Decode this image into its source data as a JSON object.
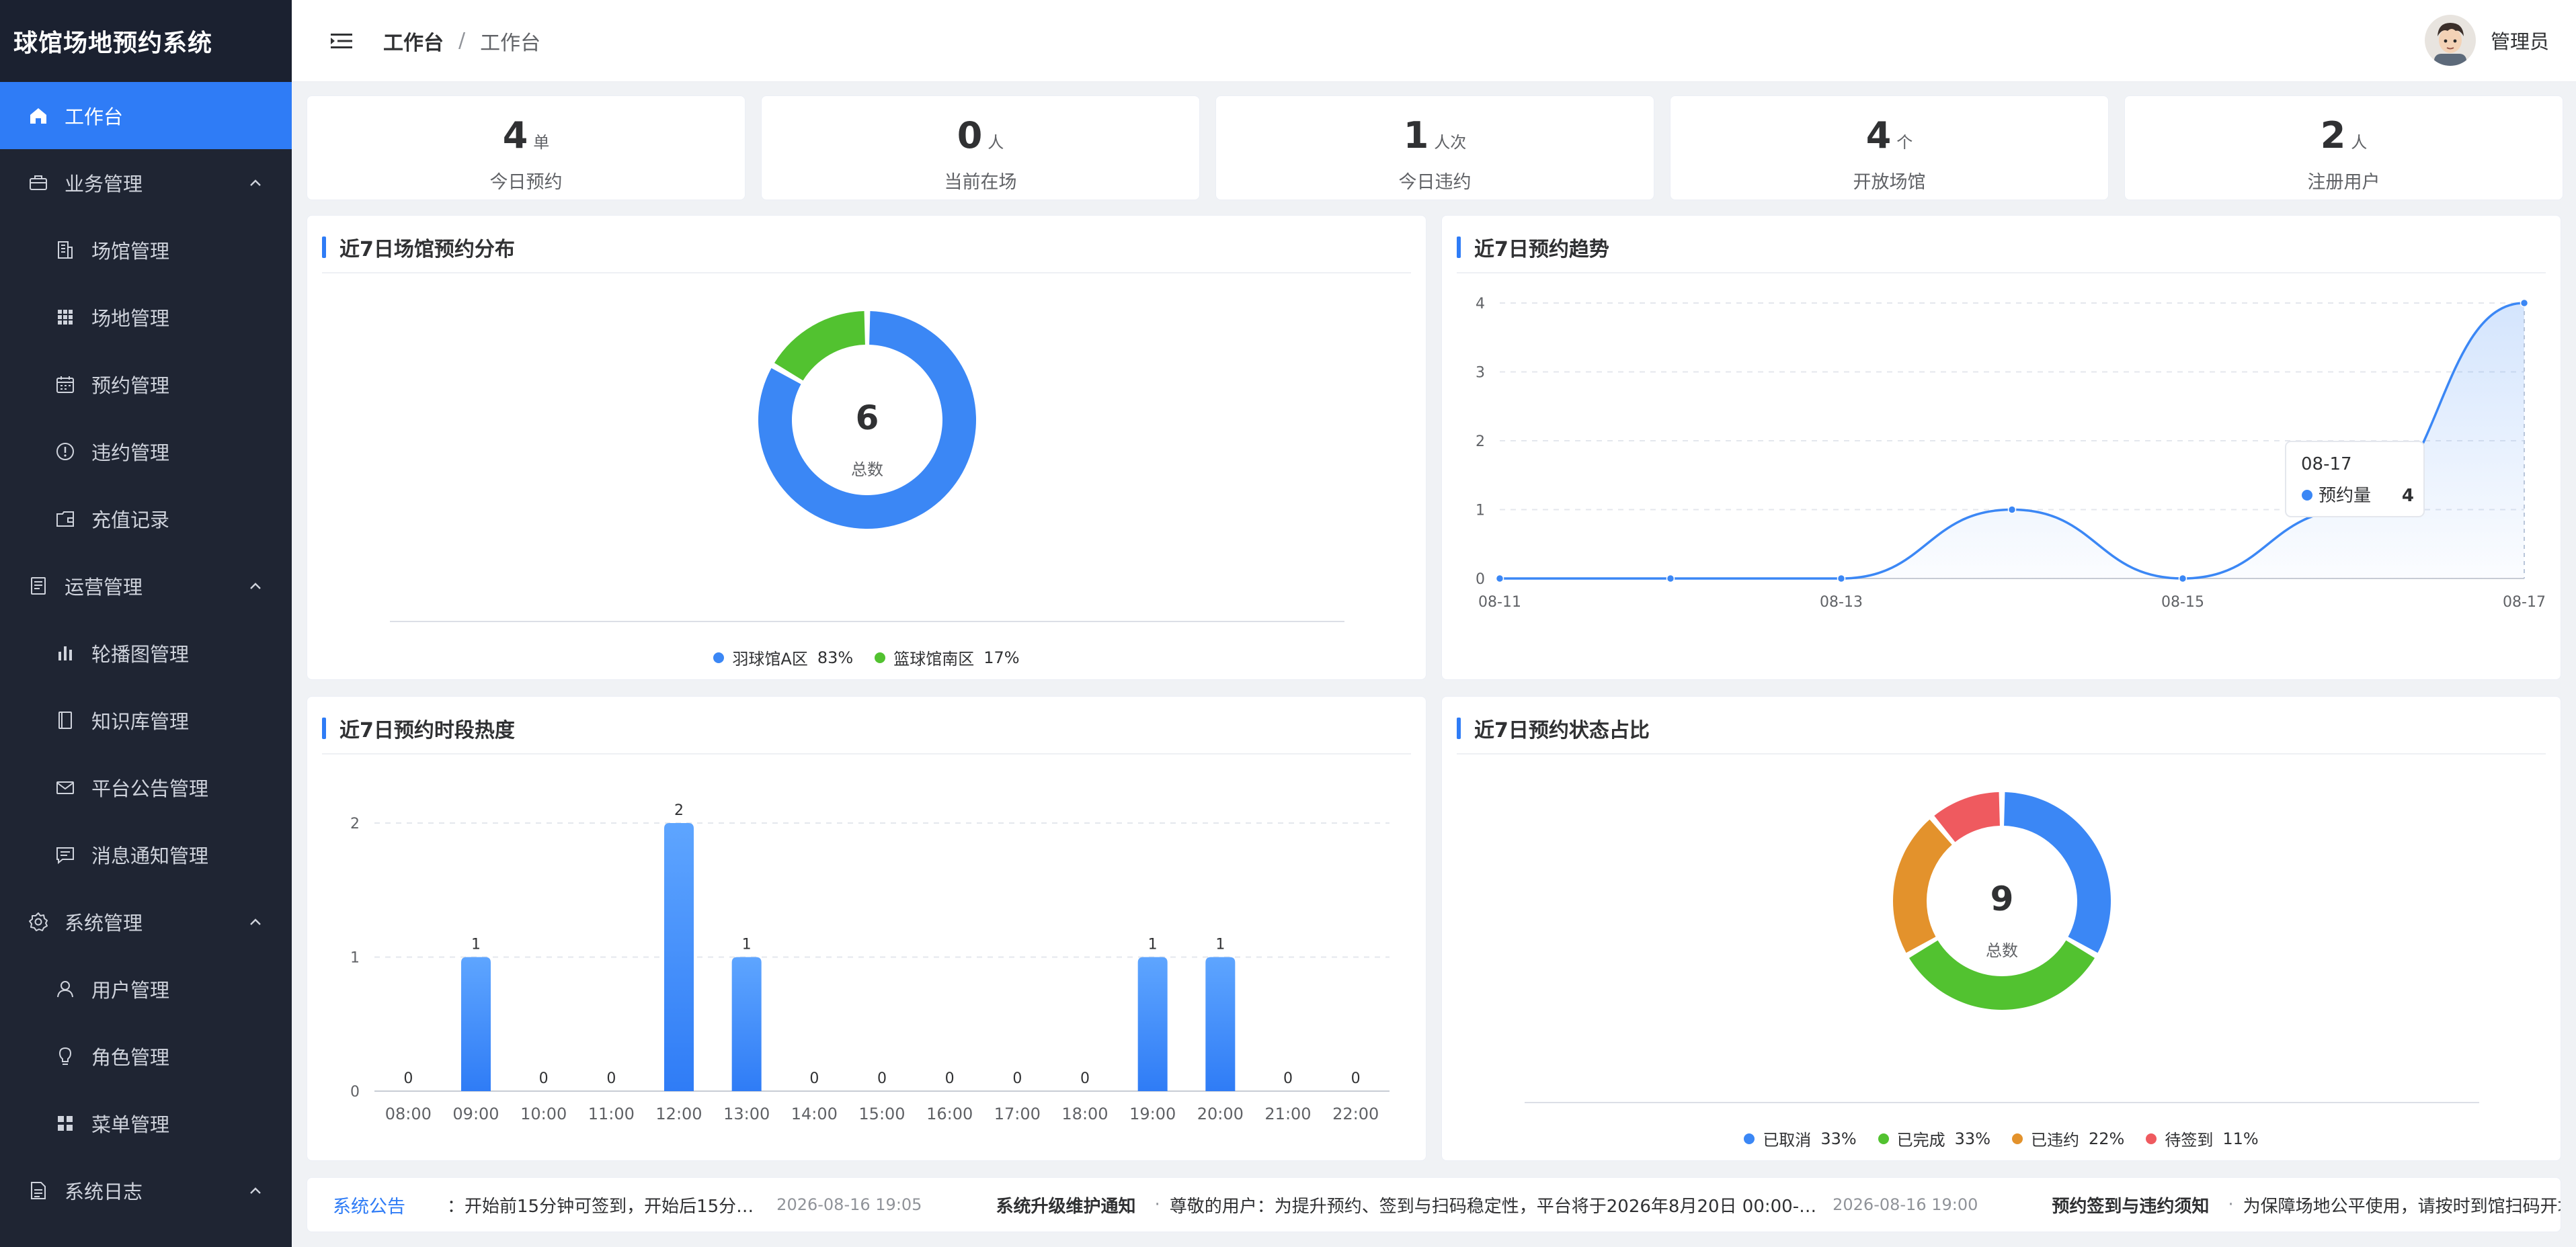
{
  "app": {
    "title": "球馆场地预约系统"
  },
  "sidebar": {
    "items": [
      {
        "label": "工作台",
        "icon": "home-icon",
        "level": 0,
        "active": true
      },
      {
        "label": "业务管理",
        "icon": "briefcase-icon",
        "level": 0,
        "expanded": true
      },
      {
        "label": "场馆管理",
        "icon": "building-icon",
        "level": 1
      },
      {
        "label": "场地管理",
        "icon": "grid-icon",
        "level": 1
      },
      {
        "label": "预约管理",
        "icon": "calendar-icon",
        "level": 1
      },
      {
        "label": "违约管理",
        "icon": "alert-circle-icon",
        "level": 1
      },
      {
        "label": "充值记录",
        "icon": "wallet-icon",
        "level": 1
      },
      {
        "label": "运营管理",
        "icon": "document-icon",
        "level": 0,
        "expanded": true
      },
      {
        "label": "轮播图管理",
        "icon": "bar-chart-icon",
        "level": 1
      },
      {
        "label": "知识库管理",
        "icon": "book-icon",
        "level": 1
      },
      {
        "label": "平台公告管理",
        "icon": "mail-icon",
        "level": 1
      },
      {
        "label": "消息通知管理",
        "icon": "message-icon",
        "level": 1
      },
      {
        "label": "系统管理",
        "icon": "gear-icon",
        "level": 0,
        "expanded": true
      },
      {
        "label": "用户管理",
        "icon": "user-icon",
        "level": 1
      },
      {
        "label": "角色管理",
        "icon": "bulb-icon",
        "level": 1
      },
      {
        "label": "菜单管理",
        "icon": "menu-grid-icon",
        "level": 1
      },
      {
        "label": "系统日志",
        "icon": "log-icon",
        "level": 0,
        "expanded": true
      }
    ]
  },
  "header": {
    "breadcrumb": [
      "工作台",
      "工作台"
    ],
    "separator": "/",
    "user": "管理员"
  },
  "stats": [
    {
      "value": "4",
      "unit": "单",
      "label": "今日预约"
    },
    {
      "value": "0",
      "unit": "人",
      "label": "当前在场"
    },
    {
      "value": "1",
      "unit": "人次",
      "label": "今日违约"
    },
    {
      "value": "4",
      "unit": "个",
      "label": "开放场馆"
    },
    {
      "value": "2",
      "unit": "人",
      "label": "注册用户"
    }
  ],
  "panels": {
    "venue_dist": {
      "title": "近7日场馆预约分布",
      "center_value": "6",
      "center_label": "总数"
    },
    "trend": {
      "title": "近7日预约趋势",
      "tooltip_date": "08-17",
      "tooltip_series": "预约量",
      "tooltip_value": "4"
    },
    "timeslot": {
      "title": "近7日预约时段热度"
    },
    "status": {
      "title": "近7日预约状态占比",
      "center_value": "9",
      "center_label": "总数"
    }
  },
  "chart_data": [
    {
      "type": "pie",
      "categories": [
        "羽球馆A区",
        "篮球馆南区"
      ],
      "values": [
        5,
        1
      ],
      "percent_labels": [
        "83%",
        "17%"
      ],
      "colors": [
        "#3b87f5",
        "#52c230"
      ],
      "legend": "bottom"
    },
    {
      "type": "line",
      "x": [
        "08-11",
        "08-12",
        "08-13",
        "08-14",
        "08-15",
        "08-16",
        "08-17"
      ],
      "x_tick_labels": [
        "08-11",
        "08-13",
        "08-15",
        "08-17"
      ],
      "series": [
        {
          "name": "预约量",
          "values": [
            0,
            0,
            0,
            1,
            0,
            1,
            4
          ]
        }
      ],
      "ylim": [
        0,
        4
      ],
      "yticks": [
        0,
        1,
        2,
        3,
        4
      ],
      "grid": true,
      "color": "#3b87f5"
    },
    {
      "type": "bar",
      "categories": [
        "08:00",
        "09:00",
        "10:00",
        "11:00",
        "12:00",
        "13:00",
        "14:00",
        "15:00",
        "16:00",
        "17:00",
        "18:00",
        "19:00",
        "20:00",
        "21:00",
        "22:00"
      ],
      "values": [
        0,
        1,
        0,
        0,
        2,
        1,
        0,
        0,
        0,
        0,
        0,
        1,
        1,
        0,
        0
      ],
      "ylim": [
        0,
        2
      ],
      "yticks": [
        0,
        1,
        2
      ],
      "grid": true,
      "color": "#3b87f5"
    },
    {
      "type": "pie",
      "categories": [
        "已取消",
        "已完成",
        "已违约",
        "待签到"
      ],
      "values": [
        3,
        3,
        2,
        1
      ],
      "percent_labels": [
        "33%",
        "33%",
        "22%",
        "11%"
      ],
      "colors": [
        "#3b87f5",
        "#52c230",
        "#e3922c",
        "#ef5a5f"
      ],
      "legend": "bottom"
    }
  ],
  "notices": {
    "tag": "系统公告",
    "items": [
      {
        "title": "",
        "text": "：开始前15分钟可签到，开始后15分…",
        "time": "2026-08-16 19:05"
      },
      {
        "title": "系统升级维护通知",
        "text": "尊敬的用户：为提升预约、签到与扫码稳定性，平台将于2026年8月20日 00:00-…",
        "time": "2026-08-16 19:00"
      },
      {
        "title": "预约签到与违约须知",
        "text": "为保障场地公平使用，请按时到馆扫码开场",
        "time": ""
      }
    ]
  }
}
